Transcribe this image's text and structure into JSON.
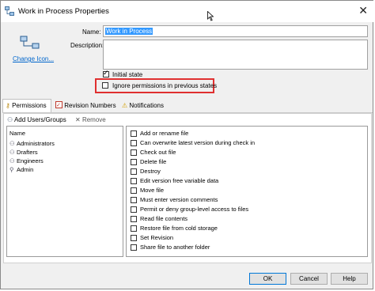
{
  "window": {
    "title": "Work in Process Properties"
  },
  "form": {
    "name_label": "Name:",
    "name_value": "Work in Process",
    "description_label": "Description:",
    "description_value": "",
    "change_icon_link": "Change Icon...",
    "initial_state_label": "Initial state",
    "initial_state_checked": true,
    "ignore_permissions_label": "Ignore permissions in previous states",
    "ignore_permissions_checked": false,
    "highlight_color": "#e03030"
  },
  "tabs": [
    {
      "label": "Permissions",
      "icon": "key-icon",
      "active": true
    },
    {
      "label": "Revision Numbers",
      "icon": "checkbox-icon",
      "active": false
    },
    {
      "label": "Notifications",
      "icon": "warning-icon",
      "active": false
    }
  ],
  "toolbar": {
    "add_label": "Add Users/Groups",
    "remove_label": "Remove"
  },
  "groups": {
    "header": "Name",
    "items": [
      "Administrators",
      "Drafters",
      "Engineers",
      "Admin"
    ]
  },
  "permissions": [
    "Add or rename file",
    "Can overwrite latest version during check in",
    "Check out file",
    "Delete file",
    "Destroy",
    "Edit version free variable data",
    "Move file",
    "Must enter version comments",
    "Permit or deny group-level access to files",
    "Read file contents",
    "Restore file from cold storage",
    "Set Revision",
    "Share file to another folder"
  ],
  "buttons": {
    "ok": "OK",
    "cancel": "Cancel",
    "help": "Help"
  }
}
